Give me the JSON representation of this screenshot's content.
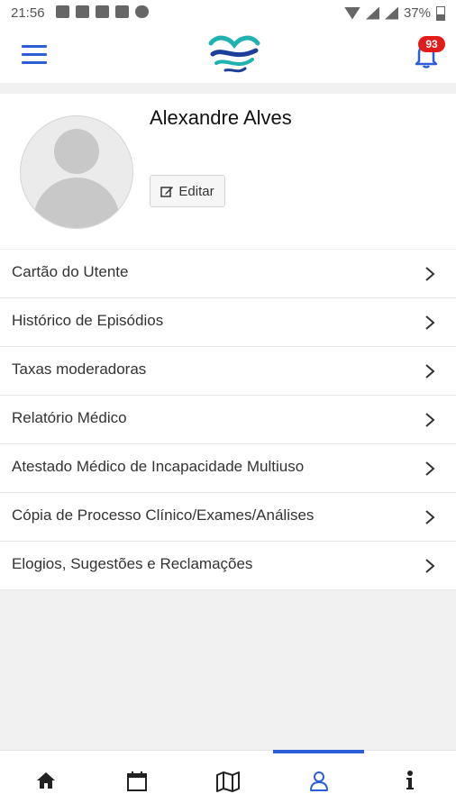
{
  "status_bar": {
    "time": "21:56",
    "battery": "37%",
    "icons": [
      "youtube-icon",
      "app-icon",
      "app-icon",
      "app-icon",
      "cloud-icon",
      "wifi-icon",
      "signal-icon",
      "battery-icon"
    ]
  },
  "header": {
    "menu_icon": "hamburger-icon",
    "logo": "heart-wave-logo",
    "notifications_count": "93",
    "colors": {
      "accent": "#2b5ed8",
      "badge": "#e21b1b",
      "logo_teal": "#1fb2b1",
      "logo_blue": "#1d3f9c"
    }
  },
  "profile": {
    "name": "Alexandre Alves",
    "edit_label": "Editar"
  },
  "menu_items": [
    {
      "label": "Cartão do Utente"
    },
    {
      "label": "Histórico de Episódios"
    },
    {
      "label": "Taxas moderadoras"
    },
    {
      "label": "Relatório Médico"
    },
    {
      "label": "Atestado Médico de Incapacidade Multiuso"
    },
    {
      "label": "Cópia de Processo Clínico/Exames/Análises"
    },
    {
      "label": "Elogios, Sugestões e Reclamações"
    }
  ],
  "bottom_nav": {
    "tabs": [
      "home-icon",
      "calendar-icon",
      "map-icon",
      "user-icon",
      "info-icon"
    ],
    "active": "user-icon"
  }
}
